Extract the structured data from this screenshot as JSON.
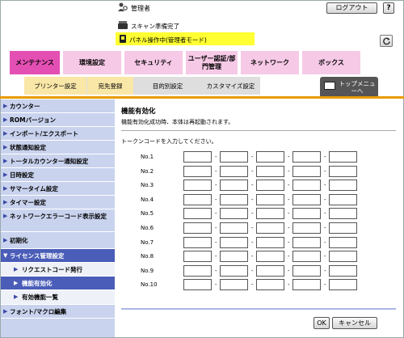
{
  "header": {
    "user_label": "管理者",
    "logout_label": "ログアウト",
    "help_label": "?",
    "scan_status": "スキャン準備完了",
    "panel_status": "パネル操作中(管理者モード)"
  },
  "main_tabs": [
    {
      "label": "メンテナンス",
      "color": "#e44fb3",
      "active": true
    },
    {
      "label": "環境設定",
      "color": "#f6c9e6"
    },
    {
      "label": "セキュリティ",
      "color": "#f6c9e6"
    },
    {
      "label": "ユーザー認証/部門管理",
      "color": "#f6c9e6"
    },
    {
      "label": "ネットワーク",
      "color": "#f6c9e6"
    },
    {
      "label": "ボックス",
      "color": "#f6c9e6"
    }
  ],
  "sub_tabs": [
    {
      "label": "プリンター設定",
      "color": "#f9e7a8"
    },
    {
      "label": "宛先登録",
      "color": "#f9e7a8"
    },
    {
      "label": "目的別設定",
      "color": "#dedede"
    },
    {
      "label": "カスタマイズ設定",
      "color": "#dedede"
    }
  ],
  "top_menu_label": "トップメニューへ",
  "sidebar": {
    "items": [
      {
        "label": "カウンター"
      },
      {
        "label": "ROMバージョン"
      },
      {
        "label": "インポート/エクスポート"
      },
      {
        "label": "状態通知設定"
      },
      {
        "label": "トータルカウンター通知設定"
      },
      {
        "label": "日時設定"
      },
      {
        "label": "サマータイム設定"
      },
      {
        "label": "タイマー設定"
      },
      {
        "label": "ネットワークエラーコード表示設定"
      },
      {
        "label": "初期化"
      },
      {
        "label": "ライセンス管理設定"
      },
      {
        "label": "リクエストコード発行"
      },
      {
        "label": "機能有効化"
      },
      {
        "label": "有効機能一覧"
      },
      {
        "label": "フォント/マクロ編集"
      }
    ]
  },
  "content": {
    "title": "機能有効化",
    "description": "機能有効化成功時、本体は再起動されます。",
    "prompt": "トークンコードを入力してください。",
    "rows": [
      {
        "label": "No.1"
      },
      {
        "label": "No.2"
      },
      {
        "label": "No.3"
      },
      {
        "label": "No.4"
      },
      {
        "label": "No.5"
      },
      {
        "label": "No.6"
      },
      {
        "label": "No.7"
      },
      {
        "label": "No.8"
      },
      {
        "label": "No.9"
      },
      {
        "label": "No.10"
      }
    ],
    "separator": "-",
    "ok_label": "OK",
    "cancel_label": "キャンセル"
  }
}
